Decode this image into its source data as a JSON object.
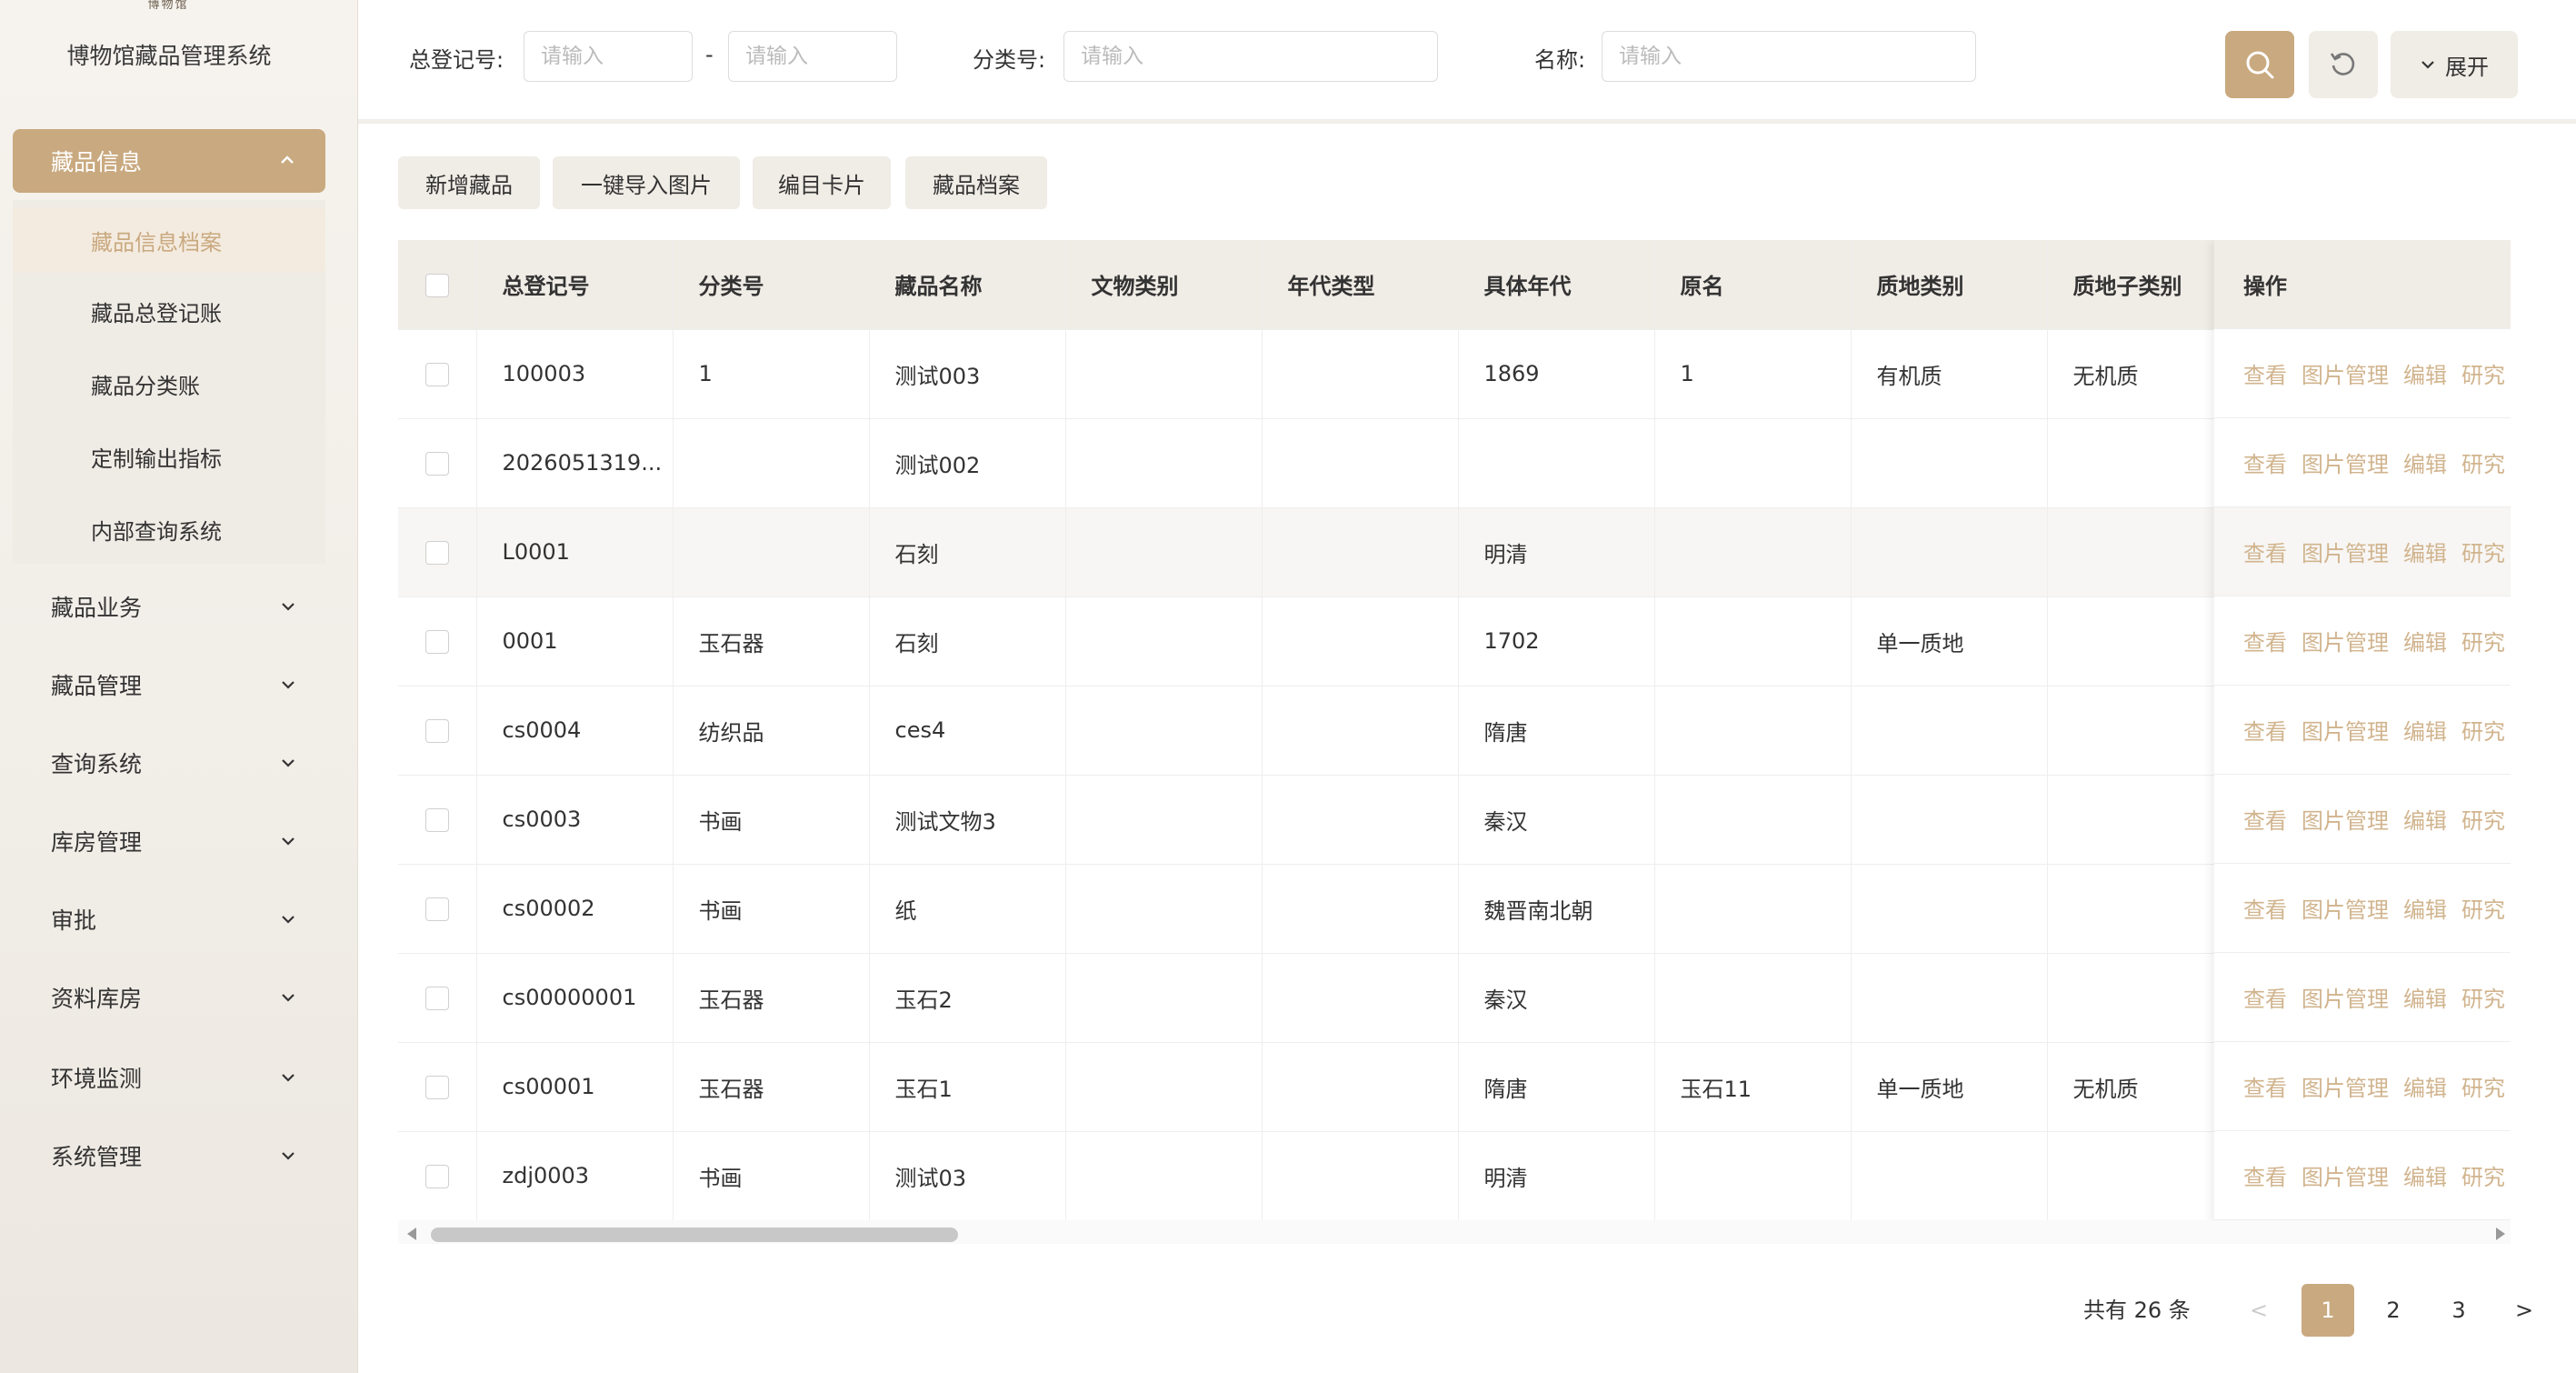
{
  "sidebar": {
    "logo_text": "博物馆",
    "system_title": "博物馆藏品管理系统",
    "active_menu": "藏品信息",
    "submenu": [
      "藏品信息档案",
      "藏品总登记账",
      "藏品分类账",
      "定制输出指标",
      "内部查询系统"
    ],
    "menus": [
      "藏品业务",
      "藏品管理",
      "查询系统",
      "库房管理",
      "审批",
      "资料库房",
      "环境监测",
      "系统管理"
    ]
  },
  "filters": {
    "reg_no_label": "总登记号:",
    "reg_no_from_placeholder": "请输入",
    "range_sep": "-",
    "reg_no_to_placeholder": "请输入",
    "class_no_label": "分类号:",
    "class_no_placeholder": "请输入",
    "name_label": "名称:",
    "name_placeholder": "请输入",
    "expand_label": "展开"
  },
  "toolbar": {
    "add_label": "新增藏品",
    "import_label": "一键导入图片",
    "card_label": "编目卡片",
    "archive_label": "藏品档案"
  },
  "table": {
    "headers": [
      "总登记号",
      "分类号",
      "藏品名称",
      "文物类别",
      "年代类型",
      "具体年代",
      "原名",
      "质地类别",
      "质地子类别"
    ],
    "ops_header": "操作",
    "ops_labels": [
      "查看",
      "图片管理",
      "编辑",
      "研究"
    ],
    "rows": [
      [
        "100003",
        "1",
        "测试003",
        "",
        "",
        "1869",
        "1",
        "有机质",
        "无机质"
      ],
      [
        "2026051319...",
        "",
        "测试002",
        "",
        "",
        "",
        "",
        "",
        ""
      ],
      [
        "L0001",
        "",
        "石刻",
        "",
        "",
        "明清",
        "",
        "",
        ""
      ],
      [
        "0001",
        "玉石器",
        "石刻",
        "",
        "",
        "1702",
        "",
        "单一质地",
        ""
      ],
      [
        "cs0004",
        "纺织品",
        "ces4",
        "",
        "",
        "隋唐",
        "",
        "",
        ""
      ],
      [
        "cs0003",
        "书画",
        "测试文物3",
        "",
        "",
        "秦汉",
        "",
        "",
        ""
      ],
      [
        "cs00002",
        "书画",
        "纸",
        "",
        "",
        "魏晋南北朝",
        "",
        "",
        ""
      ],
      [
        "cs00000001",
        "玉石器",
        "玉石2",
        "",
        "",
        "秦汉",
        "",
        "",
        ""
      ],
      [
        "cs00001",
        "玉石器",
        "玉石1",
        "",
        "",
        "隋唐",
        "玉石11",
        "单一质地",
        "无机质"
      ],
      [
        "zdj0003",
        "书画",
        "测试03",
        "",
        "",
        "明清",
        "",
        "",
        ""
      ]
    ]
  },
  "pagination": {
    "total_text": "共有 26 条",
    "prev": "<",
    "pages": [
      "1",
      "2",
      "3"
    ],
    "next": ">",
    "current": "1"
  },
  "colors": {
    "accent": "#c9a97f",
    "link": "#d1b48e",
    "header_bg": "#f0ece6"
  }
}
